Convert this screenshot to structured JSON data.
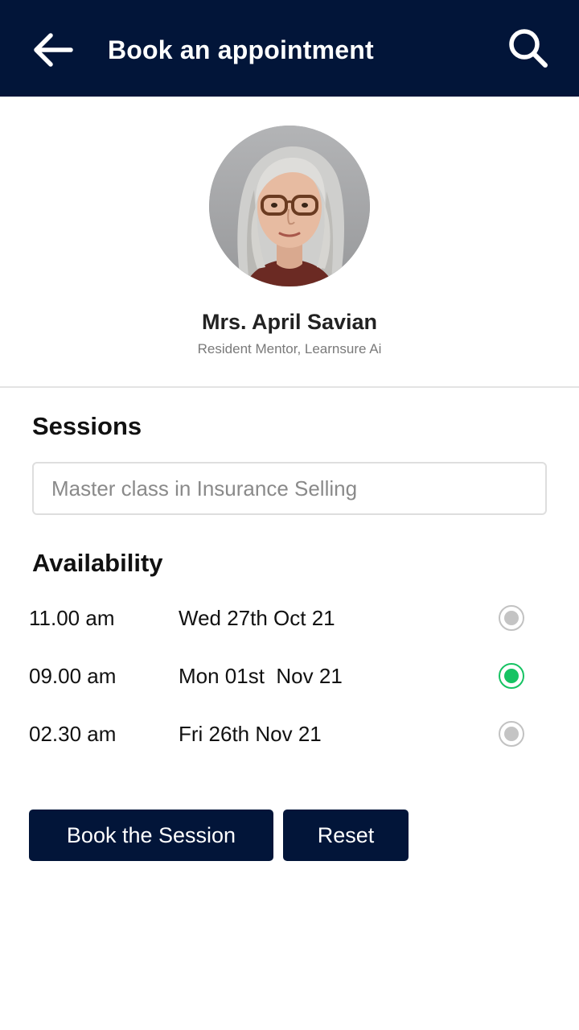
{
  "header": {
    "title": "Book an appointment",
    "back_icon": "arrow-left-icon",
    "search_icon": "search-icon",
    "background_color": "#021539"
  },
  "mentor": {
    "name": "Mrs. April Savian",
    "role": "Resident Mentor, Learnsure Ai"
  },
  "sessions": {
    "heading": "Sessions",
    "placeholder": "Master class in Insurance Selling"
  },
  "availability": {
    "heading": "Availability",
    "slots": [
      {
        "time": "11.00 am",
        "date": "Wed 27th Oct 21",
        "selected": false
      },
      {
        "time": "09.00 am",
        "date": "Mon 01st  Nov 21",
        "selected": true
      },
      {
        "time": "02.30 am",
        "date": "Fri 26th Nov 21",
        "selected": false
      }
    ],
    "selected_color": "#16c363"
  },
  "actions": {
    "book_label": "Book the Session",
    "reset_label": "Reset",
    "button_color": "#021539"
  }
}
